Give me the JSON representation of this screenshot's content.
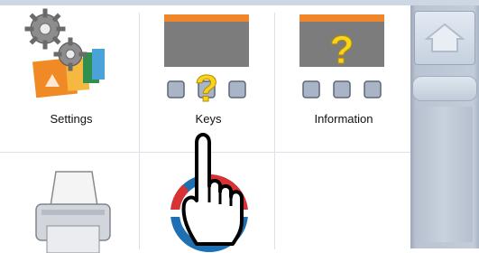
{
  "tiles": [
    {
      "label": "Settings",
      "icon": "settings-icon"
    },
    {
      "label": "Keys",
      "icon": "keys-icon"
    },
    {
      "label": "Information",
      "icon": "information-icon"
    },
    {
      "label": "",
      "icon": "printer-icon"
    },
    {
      "label": "",
      "icon": "lifebuoy-icon"
    }
  ],
  "sidebar": {
    "home_icon": "home-icon",
    "scroll_grip": "scroll-grip"
  },
  "cursor": {
    "icon": "hand-pointer-icon"
  },
  "colors": {
    "accent_orange": "#f0852a",
    "question_yellow": "#f7d51c",
    "panel_gray": "#b9c3d2"
  }
}
